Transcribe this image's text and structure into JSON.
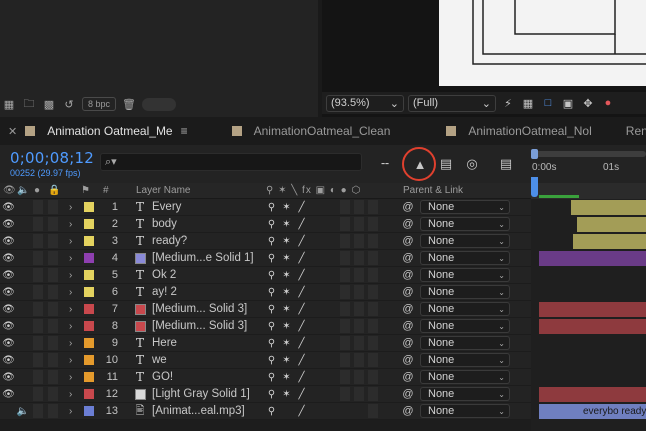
{
  "project_panel": {
    "bpc": "8 bpc"
  },
  "viewer": {
    "zoom": "(93.5%)",
    "resolution": "(Full)"
  },
  "tabs": [
    {
      "label": "Animation Oatmeal_Me",
      "active": true
    },
    {
      "label": "AnimationOatmeal_Clean",
      "active": false
    },
    {
      "label": "AnimationOatmeal_Nol",
      "active": false
    },
    {
      "label": "Render",
      "active": false
    }
  ],
  "timeline": {
    "timecode": "0;00;08;12",
    "fps_readout": "00252 (29.97 fps)",
    "search_placeholder": "⌕▾",
    "ruler_labels": [
      "0:00s",
      "01s"
    ]
  },
  "columns": {
    "number": "#",
    "layer_name": "Layer Name",
    "switches": "⚲ ✶ ╲ fx ▣ ◐ ● ⬡",
    "parent": "Parent & Link"
  },
  "parent_default": "None",
  "colors": {
    "accent_blue": "#4f9bff",
    "highlight_red": "#e0402e",
    "label_yellow": "#e3d25f",
    "label_purple": "#8e3fb0",
    "label_red": "#c8484d",
    "label_orange": "#e49a2c",
    "label_blue": "#6b7ed4",
    "label_light_gray": "#d9d9d9"
  },
  "layers": [
    {
      "num": "1",
      "type": "text",
      "name": "Every",
      "label_color": "#e3d25f"
    },
    {
      "num": "2",
      "type": "text",
      "name": "body",
      "label_color": "#e3d25f"
    },
    {
      "num": "3",
      "type": "text",
      "name": "ready?",
      "label_color": "#e3d25f"
    },
    {
      "num": "4",
      "type": "solid",
      "name": "[Medium...e Solid 1]",
      "label_color": "#8e3fb0",
      "solid_color": "#8a8ad8"
    },
    {
      "num": "5",
      "type": "text",
      "name": "Ok 2",
      "label_color": "#e3d25f"
    },
    {
      "num": "6",
      "type": "text",
      "name": "ay! 2",
      "label_color": "#e3d25f"
    },
    {
      "num": "7",
      "type": "solid",
      "name": "[Medium... Solid 3]",
      "label_color": "#c8484d",
      "solid_color": "#c8484d"
    },
    {
      "num": "8",
      "type": "solid",
      "name": "[Medium... Solid 3]",
      "label_color": "#c8484d",
      "solid_color": "#c8484d"
    },
    {
      "num": "9",
      "type": "text",
      "name": "Here",
      "label_color": "#e49a2c"
    },
    {
      "num": "10",
      "type": "text",
      "name": "we",
      "label_color": "#e49a2c"
    },
    {
      "num": "11",
      "type": "text",
      "name": "GO!",
      "label_color": "#e49a2c"
    },
    {
      "num": "12",
      "type": "solid",
      "name": "[Light Gray Solid 1]",
      "label_color": "#c8484d",
      "solid_color": "#d9d9d9"
    },
    {
      "num": "13",
      "type": "audio",
      "name": "[Animat...eal.mp3]",
      "label_color": "#6b7ed4"
    }
  ],
  "audio_clip_text": "everybo ready"
}
